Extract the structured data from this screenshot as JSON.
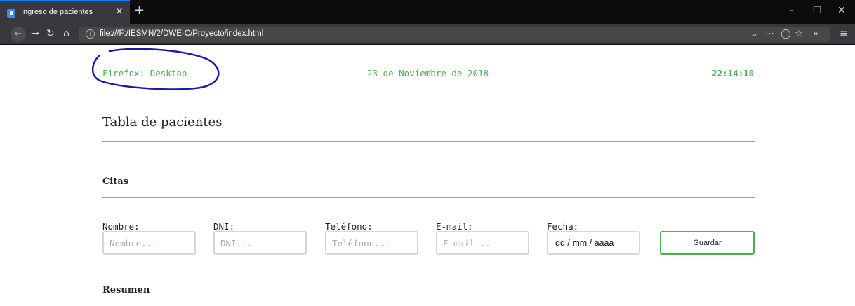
{
  "browser": {
    "tab_title": "Ingreso de pacientes",
    "tab_close": "×",
    "new_tab": "+",
    "url": "file:///F:/IESMN/2/DWE-C/Proyecto/index.html",
    "accent_color": "#0a84ff",
    "icons": [
      "back-icon",
      "forward-icon",
      "reload-icon",
      "home-icon",
      "info-icon",
      "chevron-down-icon",
      "more-icon",
      "pocket-icon",
      "bookmark-star-icon",
      "overflow-icon",
      "menu-icon",
      "minimize-icon",
      "restore-icon",
      "close-icon"
    ]
  },
  "header": {
    "device": "Firefox: Desktop",
    "date": "23 de Noviembre de 2018",
    "time": "22:14:10",
    "text_color": "#4caf50",
    "annotation_color": "#1a1aa8"
  },
  "main": {
    "title": "Tabla de pacientes",
    "citas_heading": "Citas",
    "resumen_heading": "Resumen"
  },
  "form": {
    "fields": [
      {
        "label": "Nombre:",
        "placeholder": "Nombre..."
      },
      {
        "label": "DNI:",
        "placeholder": "DNI..."
      },
      {
        "label": "Teléfono:",
        "placeholder": "Teléfono..."
      },
      {
        "label": "E-mail:",
        "placeholder": "E-mail..."
      },
      {
        "label": "Fecha:",
        "value": "dd / mm / aaaa"
      }
    ],
    "save_label": "Guardar",
    "button_border_color": "#4caf50"
  }
}
